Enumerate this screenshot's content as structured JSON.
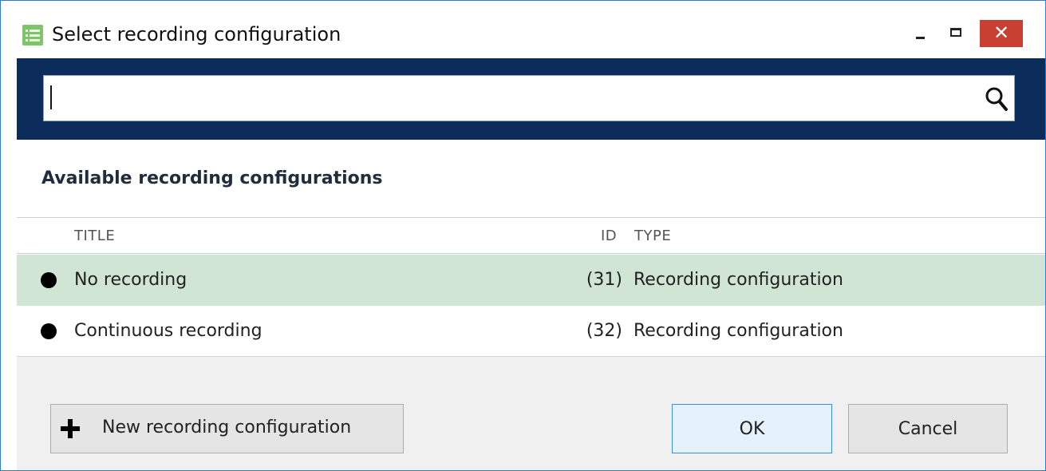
{
  "window": {
    "title": "Select recording configuration",
    "close_glyph": "✕",
    "icons": {
      "app": "list-app-icon",
      "minimize": "minimize-icon",
      "maximize": "maximize-icon",
      "close": "close-icon"
    }
  },
  "search": {
    "value": "",
    "placeholder": "",
    "icon": "search-icon"
  },
  "section": {
    "title": "Available recording configurations"
  },
  "table": {
    "columns": {
      "title": "TITLE",
      "id": "ID",
      "type": "TYPE"
    },
    "rows": [
      {
        "title": "No recording",
        "id": "(31)",
        "type": "Recording configuration",
        "selected": true
      },
      {
        "title": "Continuous recording",
        "id": "(32)",
        "type": "Recording configuration",
        "selected": false
      }
    ]
  },
  "footer": {
    "new_label": "New recording configuration",
    "ok_label": "OK",
    "cancel_label": "Cancel"
  },
  "colors": {
    "header_band": "#0c2d5c",
    "selected_row": "#d0e5d3",
    "close_button": "#c84031",
    "window_border": "#2b7cd3"
  }
}
